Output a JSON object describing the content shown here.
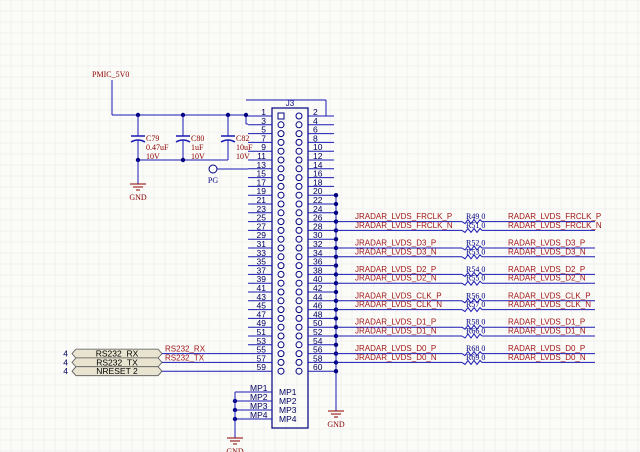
{
  "colors": {
    "wire": "#1a1ab4",
    "net_label": "#a01818",
    "part": "#000080",
    "designator": "#8b0000",
    "background": "#fbfbf8",
    "grid": "#e6e6e6",
    "port_fill": "#e8e4d0"
  },
  "power": {
    "pmic_label": "PMIC_5V0",
    "gnd_label": "GND"
  },
  "testpoint": {
    "label": "PG"
  },
  "capacitors": [
    {
      "ref": "C79",
      "value": "0.47uF",
      "voltage": "10V"
    },
    {
      "ref": "C80",
      "value": "1uF",
      "voltage": "10V"
    },
    {
      "ref": "C82",
      "value": "10uF",
      "voltage": "10V"
    }
  ],
  "connector": {
    "ref": "J3",
    "pin_count": 60,
    "mount_pins": [
      "MP1",
      "MP2",
      "MP3",
      "MP4"
    ]
  },
  "ports": [
    {
      "name": "RS232_RX",
      "sheet": "4",
      "net": "RS232_RX",
      "pin": 55
    },
    {
      "name": "RS232_TX",
      "sheet": "4",
      "net": "RS232_TX",
      "pin": 57
    },
    {
      "name": "NRESET 2",
      "sheet": "4",
      "net": "",
      "pin": 59
    }
  ],
  "lvds": [
    {
      "pin": 26,
      "left": "JRADAR_LVDS_FRCLK_P",
      "res": "R49",
      "val": "0",
      "right": "RADAR_LVDS_FRCLK_P"
    },
    {
      "pin": 28,
      "left": "JRADAR_LVDS_FRCLK_N",
      "res": "R51",
      "val": "0",
      "right": "RADAR_LVDS_FRCLK_N"
    },
    {
      "pin": 32,
      "left": "JRADAR_LVDS_D3_P",
      "res": "R52",
      "val": "0",
      "right": "RADAR_LVDS_D3_P"
    },
    {
      "pin": 34,
      "left": "JRADAR_LVDS_D3_N",
      "res": "R53",
      "val": "0",
      "right": "RADAR_LVDS_D3_N"
    },
    {
      "pin": 38,
      "left": "JRADAR_LVDS_D2_P",
      "res": "R54",
      "val": "0",
      "right": "RADAR_LVDS_D2_P"
    },
    {
      "pin": 40,
      "left": "JRADAR_LVDS_D2_N",
      "res": "R55",
      "val": "0",
      "right": "RADAR_LVDS_D2_N"
    },
    {
      "pin": 44,
      "left": "JRADAR_LVDS_CLK_P",
      "res": "R56",
      "val": "0",
      "right": "RADAR_LVDS_CLK_P"
    },
    {
      "pin": 46,
      "left": "JRADAR_LVDS_CLK_N",
      "res": "R57",
      "val": "0",
      "right": "RADAR_LVDS_CLK_N"
    },
    {
      "pin": 50,
      "left": "JRADAR_LVDS_D1_P",
      "res": "R58",
      "val": "0",
      "right": "RADAR_LVDS_D1_P"
    },
    {
      "pin": 52,
      "left": "JRADAR_LVDS_D1_N",
      "res": "R66",
      "val": "0",
      "right": "RADAR_LVDS_D1_N"
    },
    {
      "pin": 56,
      "left": "JRADAR_LVDS_D0_P",
      "res": "R68",
      "val": "0",
      "right": "RADAR_LVDS_D0_P"
    },
    {
      "pin": 58,
      "left": "JRADAR_LVDS_D0_N",
      "res": "R69",
      "val": "0",
      "right": "RADAR_LVDS_D0_N"
    }
  ],
  "gnd_pins": [
    20,
    22,
    24,
    30,
    36,
    42,
    48,
    54,
    60
  ]
}
